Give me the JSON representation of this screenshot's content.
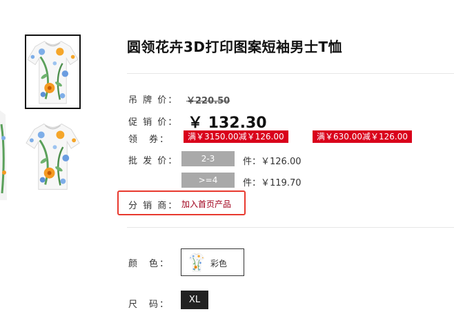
{
  "product": {
    "title": "圆领花卉3D打印图案短袖男士T恤"
  },
  "pricing": {
    "list_price_label": "吊 牌 价：",
    "list_price": "￥220.50",
    "promo_price_label": "促 销 价：",
    "promo_price": "￥ 132.30"
  },
  "coupons": {
    "label": "领　券：",
    "items": [
      "满￥3150.00减￥126.00",
      "满￥630.00减￥126.00"
    ]
  },
  "wholesale": {
    "label": "批 发 价：",
    "tiers": [
      {
        "qty": "2-3",
        "price": "件：￥126.00"
      },
      {
        "qty": ">=4",
        "price": "件：￥119.70"
      }
    ]
  },
  "distributor": {
    "label": "分 销 商：",
    "link": "加入首页产品"
  },
  "color": {
    "label": "颜　色：",
    "option": "彩色"
  },
  "size": {
    "label": "尺　码：",
    "option": "XL"
  },
  "colors": {
    "coupon_bg": "#d9001b",
    "tier_bg": "#a9a9a9",
    "highlight_border": "#e8392e",
    "link": "#a0001b"
  }
}
